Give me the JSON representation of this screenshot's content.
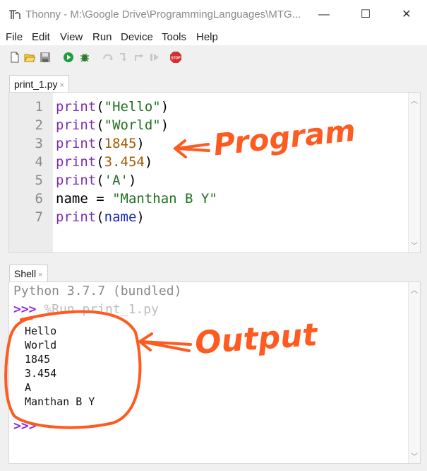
{
  "window": {
    "title": "Thonny  -  M:\\Google Drive\\ProgrammingLanguages\\MTG...",
    "minimize_glyph": "—",
    "maximize_glyph": "☐",
    "close_glyph": "✕"
  },
  "menu": [
    "File",
    "Edit",
    "View",
    "Run",
    "Device",
    "Tools",
    "Help"
  ],
  "toolbar": {
    "icons": [
      "new-file-icon",
      "open-file-icon",
      "save-icon",
      "run-icon",
      "debug-icon",
      "step-over-icon",
      "step-into-icon",
      "step-out-icon",
      "resume-icon",
      "stop-icon"
    ],
    "stop_label": "STOP"
  },
  "editor_tab": {
    "label": "print_1.py",
    "close": "×"
  },
  "editor": {
    "line_numbers": [
      "1",
      "2",
      "3",
      "4",
      "5",
      "6",
      "7"
    ],
    "lines": [
      [
        {
          "t": "print",
          "c": "kw"
        },
        {
          "t": "(",
          "c": ""
        },
        {
          "t": "\"Hello\"",
          "c": "str"
        },
        {
          "t": ")",
          "c": ""
        }
      ],
      [
        {
          "t": "print",
          "c": "kw"
        },
        {
          "t": "(",
          "c": ""
        },
        {
          "t": "\"World\"",
          "c": "str"
        },
        {
          "t": ")",
          "c": ""
        }
      ],
      [
        {
          "t": "print",
          "c": "kw"
        },
        {
          "t": "(",
          "c": ""
        },
        {
          "t": "1845",
          "c": "num"
        },
        {
          "t": ")",
          "c": ""
        }
      ],
      [
        {
          "t": "print",
          "c": "kw"
        },
        {
          "t": "(",
          "c": ""
        },
        {
          "t": "3.454",
          "c": "num"
        },
        {
          "t": ")",
          "c": ""
        }
      ],
      [
        {
          "t": "print",
          "c": "kw"
        },
        {
          "t": "(",
          "c": ""
        },
        {
          "t": "'A'",
          "c": "str"
        },
        {
          "t": ")",
          "c": ""
        }
      ],
      [
        {
          "t": "name = ",
          "c": ""
        },
        {
          "t": "\"Manthan B Y\"",
          "c": "str"
        }
      ],
      [
        {
          "t": "print",
          "c": "kw"
        },
        {
          "t": "(",
          "c": ""
        },
        {
          "t": "name",
          "c": "var"
        },
        {
          "t": ")",
          "c": ""
        }
      ]
    ]
  },
  "shell_tab": {
    "label": "Shell",
    "close": "×"
  },
  "shell": {
    "banner": "Python 3.7.7 (bundled)",
    "prompt": ">>>",
    "command": "%Run print_1.py",
    "output": [
      "Hello",
      "World",
      "1845",
      "3.454",
      "A",
      "Manthan B Y"
    ]
  },
  "annotations": {
    "program_label": "Program",
    "output_label": "Output",
    "color": "#ff5a1f"
  }
}
